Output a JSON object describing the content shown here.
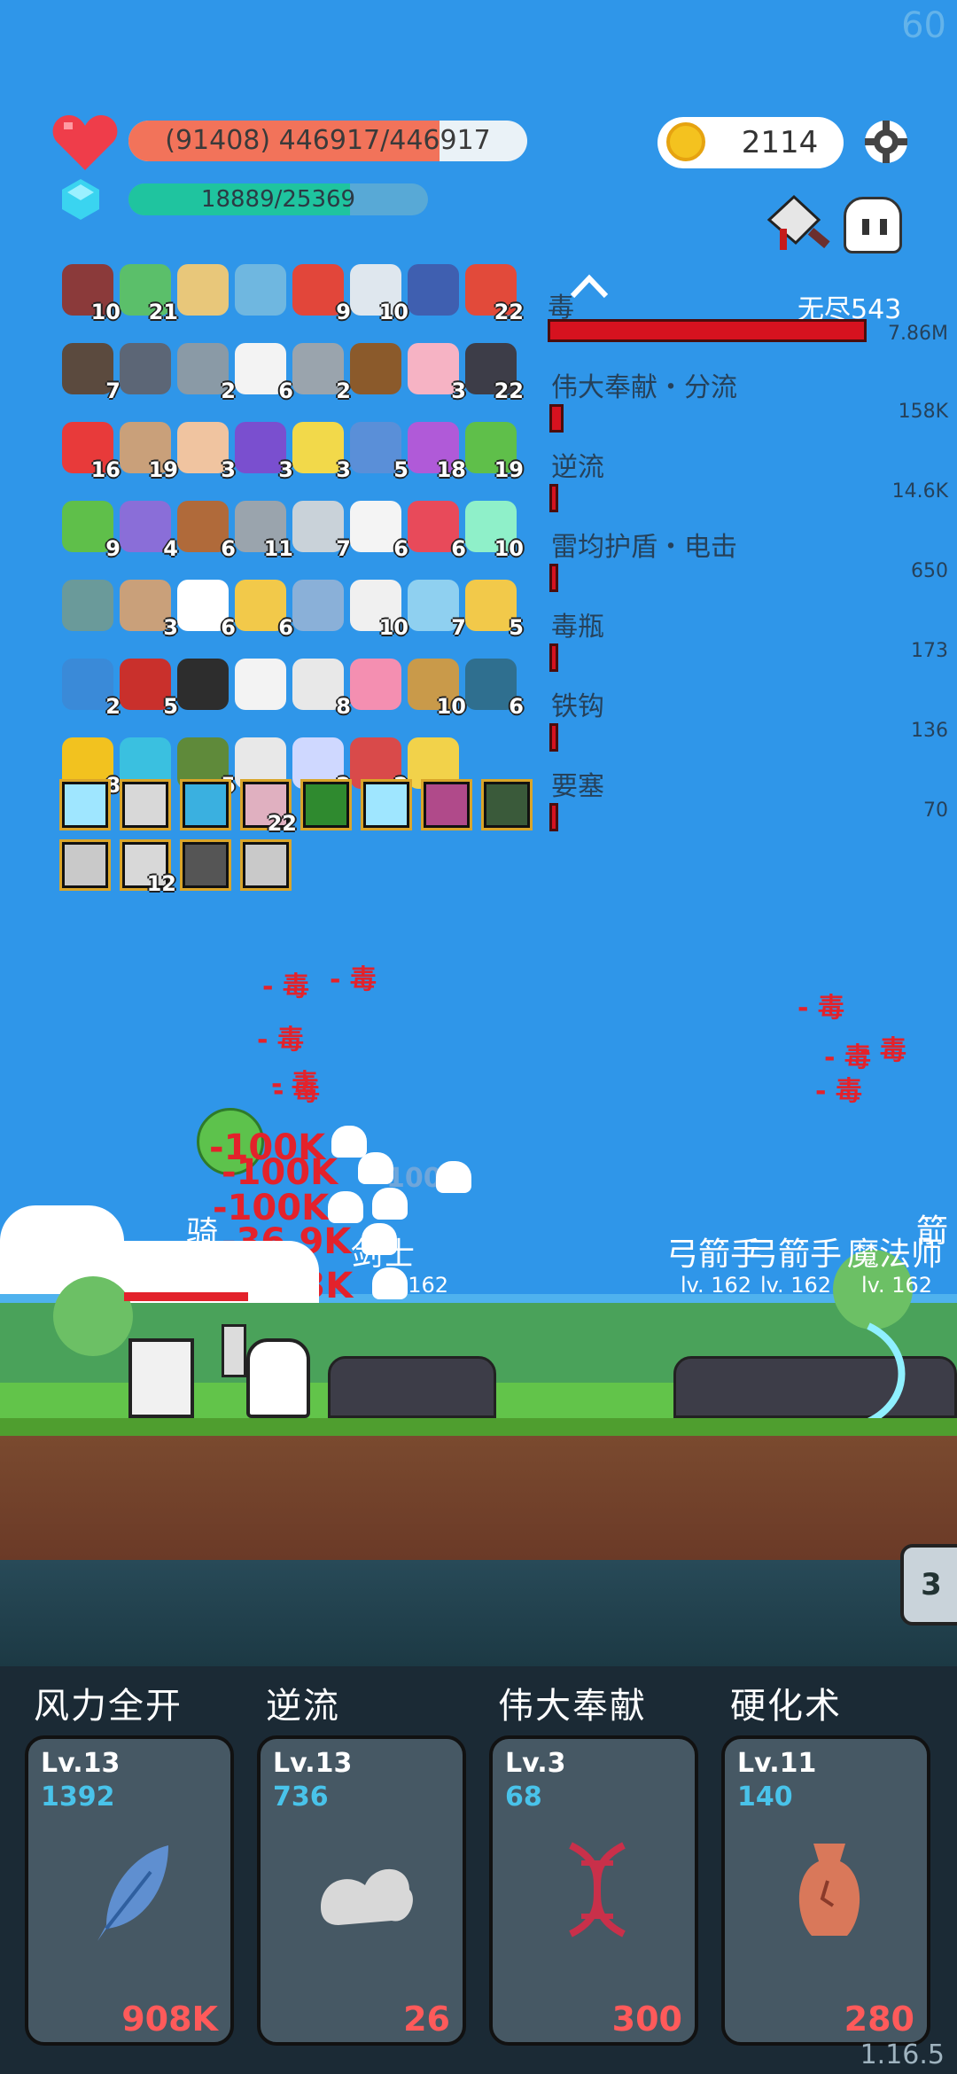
{
  "hud": {
    "fps": "60",
    "hp_text": "(91408) 446917/446917",
    "hp_fraction": 0.78,
    "mp_text": "18889/25369",
    "mp_fraction": 0.74,
    "coins": "2114",
    "version": "1.16.5"
  },
  "inventory": {
    "row1": [
      "10",
      "21",
      "",
      "",
      "9",
      "10",
      "",
      "22"
    ],
    "row2": [
      "7",
      "",
      "2",
      "6",
      "2",
      "",
      "3",
      "22"
    ],
    "row3": [
      "16",
      "19",
      "3",
      "3",
      "3",
      "5",
      "18",
      "19"
    ],
    "row4": [
      "9",
      "4",
      "6",
      "11",
      "7",
      "6",
      "6",
      "10"
    ],
    "row5": [
      "",
      "3",
      "6",
      "6",
      "",
      "10",
      "7",
      "5"
    ],
    "row6": [
      "2",
      "5",
      "",
      "",
      "8",
      "",
      "10",
      "6"
    ],
    "row7": [
      "8",
      "",
      "5",
      "",
      "2",
      "2",
      ""
    ],
    "equip1": [
      "",
      "",
      "",
      "22",
      "",
      "",
      "",
      ""
    ],
    "equip2": [
      "",
      "12",
      "",
      ""
    ]
  },
  "damage_panel": {
    "header_partial": "毒",
    "stage": "无尽543",
    "top_value": "7.86M",
    "rows": [
      {
        "name": "伟大奉献・分流",
        "value": "158K"
      },
      {
        "name": "逆流",
        "value": "14.6K"
      },
      {
        "name": "雷均护盾・电击",
        "value": "650"
      },
      {
        "name": "毒瓶",
        "value": "173"
      },
      {
        "name": "铁钩",
        "value": "136"
      },
      {
        "name": "要塞",
        "value": "70"
      }
    ]
  },
  "battle": {
    "poison_left": [
      "- 毒",
      "- 毒",
      "- 毒",
      "- 毒",
      "- 毒"
    ],
    "poison_right": [
      "- 毒",
      "- 毒",
      "- 毒",
      "- 毒"
    ],
    "damage_numbers": [
      "-100K",
      "-100K",
      "-100K",
      "-36.9K",
      "-44.3K"
    ],
    "faded_text": "100K",
    "ally_units": [
      {
        "name": "骑",
        "level": "lv. 162"
      },
      {
        "name": "剑士",
        "level": "lv. 162"
      }
    ],
    "enemy_units": [
      {
        "name": "弓箭手",
        "level": "lv. 162"
      },
      {
        "name": "弓箭手",
        "level": "lv. 162"
      },
      {
        "name": "魔法师",
        "level": "lv. 162"
      },
      {
        "name": "箭",
        "level": ""
      }
    ],
    "side_tab": "3"
  },
  "skills": [
    {
      "title": "风力全开",
      "level": "Lv.13",
      "cost": "1392",
      "price": "908K",
      "icon": "feather-icon"
    },
    {
      "title": "逆流",
      "level": "Lv.13",
      "cost": "736",
      "price": "26",
      "icon": "cloud-wind-icon"
    },
    {
      "title": "伟大奉献",
      "level": "Lv.3",
      "cost": "68",
      "price": "300",
      "icon": "dna-icon"
    },
    {
      "title": "硬化术",
      "level": "Lv.11",
      "cost": "140",
      "price": "280",
      "icon": "vase-icon"
    }
  ],
  "colors": {
    "sky": "#2f96e9",
    "hp": "#f2735a",
    "mp": "#1fc49f",
    "damage": "#e3222b",
    "cost": "#49c3ea",
    "price": "#ff5a5a"
  }
}
